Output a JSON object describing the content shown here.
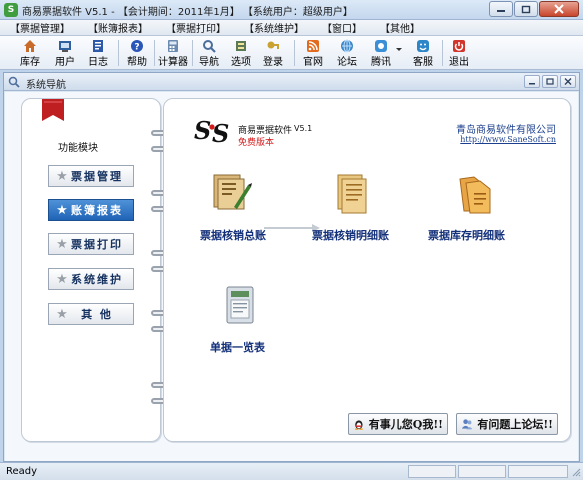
{
  "window": {
    "title": "商易票据软件 V5.1 - 【会计期间：2011年1月】 【系统用户：超级用户】",
    "icon": "app-logo-icon"
  },
  "menu": [
    "【票据管理】",
    "【账簿报表】",
    "【票据打印】",
    "【系统维护】",
    "【窗口】",
    "【其他】"
  ],
  "toolbar": {
    "items": [
      {
        "label": "库存",
        "icon": "house-icon",
        "color": "#c96b2a"
      },
      {
        "label": "用户",
        "icon": "user-icon",
        "color": "#2f5f9e"
      },
      {
        "label": "日志",
        "icon": "log-icon",
        "color": "#2c5aa8"
      },
      {
        "label": "帮助",
        "icon": "help-icon",
        "color": "#2a56b8"
      },
      {
        "label": "计算器",
        "icon": "calculator-icon",
        "color": "#6a8ab2"
      },
      {
        "label": "导航",
        "icon": "navigation-icon",
        "color": "#4d6e9d"
      },
      {
        "label": "选项",
        "icon": "options-icon",
        "color": "#5a7a55"
      },
      {
        "label": "登录",
        "icon": "login-icon",
        "color": "#c9a232"
      },
      {
        "label": "官网",
        "icon": "website-icon",
        "color": "#e36b1d"
      },
      {
        "label": "论坛",
        "icon": "forum-icon",
        "color": "#3c86c8"
      },
      {
        "label": "腾讯",
        "icon": "tencent-icon",
        "color": "#3b8fd6"
      },
      {
        "label": "客服",
        "icon": "service-icon",
        "color": "#2d86c7"
      },
      {
        "label": "退出",
        "icon": "exit-icon",
        "color": "#d2352b"
      }
    ]
  },
  "child_window": {
    "title": "系统导航",
    "icon": "navigation-window-icon"
  },
  "left_panel": {
    "title": "功能模块",
    "modules": [
      {
        "label": "票据管理",
        "active": false
      },
      {
        "label": "账簿报表",
        "active": true
      },
      {
        "label": "票据打印",
        "active": false
      },
      {
        "label": "系统维护",
        "active": false
      },
      {
        "label": "其 他",
        "active": false
      }
    ]
  },
  "right_panel": {
    "product_name": "商易票据软件",
    "version": "V5.1",
    "edition": "免费版本",
    "company": "青岛商易软件有限公司",
    "url": "http://www.SaneSoft.cn",
    "features": [
      {
        "label": "票据核销总账",
        "icon": "summary-ledger-icon"
      },
      {
        "label": "票据核销明细账",
        "icon": "detail-ledger-icon"
      },
      {
        "label": "票据库存明细账",
        "icon": "inventory-ledger-icon"
      },
      {
        "label": "单据一览表",
        "icon": "document-list-icon"
      }
    ],
    "qq_button": "有事儿您Q我!!",
    "forum_button": "有问题上论坛!!"
  },
  "status": {
    "text": "Ready"
  }
}
